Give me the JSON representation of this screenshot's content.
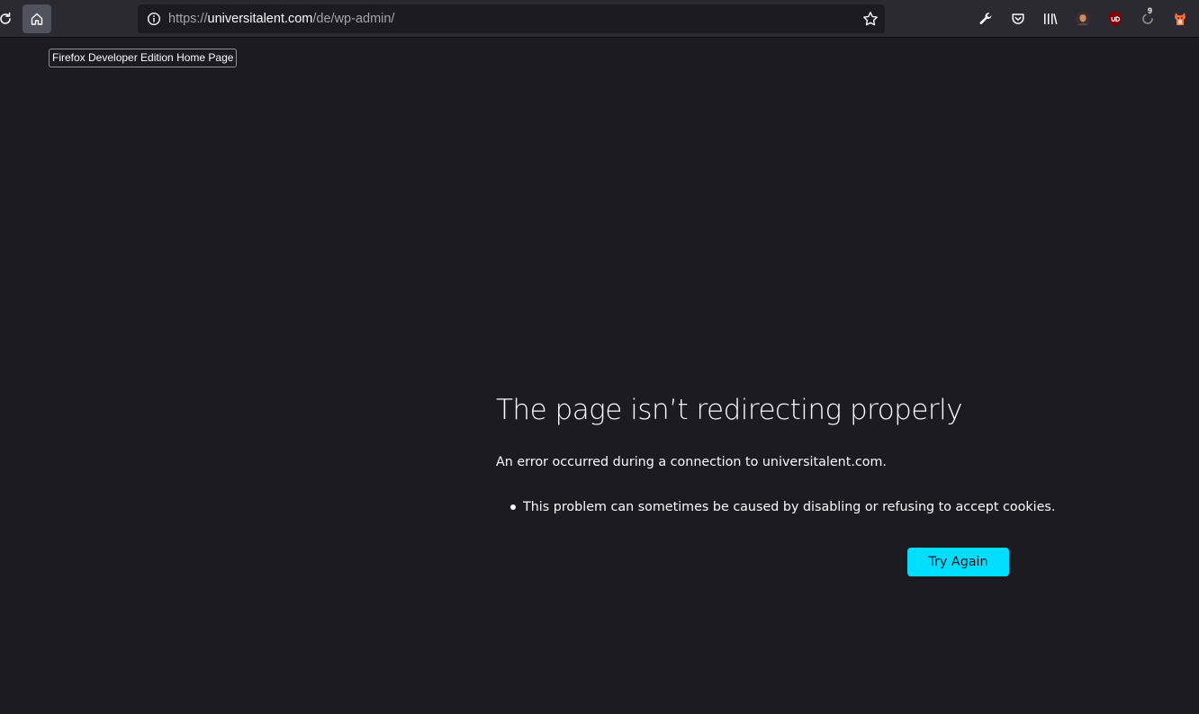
{
  "toolbar": {
    "reload_icon": "reload-icon",
    "home_icon": "home-icon",
    "home_tooltip": "Firefox Developer Edition Home Page",
    "urlbar": {
      "scheme": "https://",
      "host": "universitalent.com",
      "path": "/de/wp-admin/",
      "info_icon": "info-icon",
      "bookmark_icon": "star-icon"
    },
    "right_icons": [
      "wrench-icon",
      "pocket-icon",
      "library-icon",
      "account-avatar-icon",
      "ublock-origin-icon",
      "sync-icon",
      "fox-extension-icon"
    ],
    "sync_badge": "9"
  },
  "error": {
    "title": "The page isn’t redirecting properly",
    "description": "An error occurred during a connection to universitalent.com.",
    "bullets": [
      "This problem can sometimes be caused by disabling or refusing to accept cookies."
    ],
    "button_label": "Try Again"
  },
  "colors": {
    "background": "#1c1b22",
    "toolbar": "#2b2a33",
    "text": "#fbfbfe",
    "button_primary": "#00ddff",
    "ublock_red": "#800000",
    "fox_orange": "#ff7139"
  }
}
